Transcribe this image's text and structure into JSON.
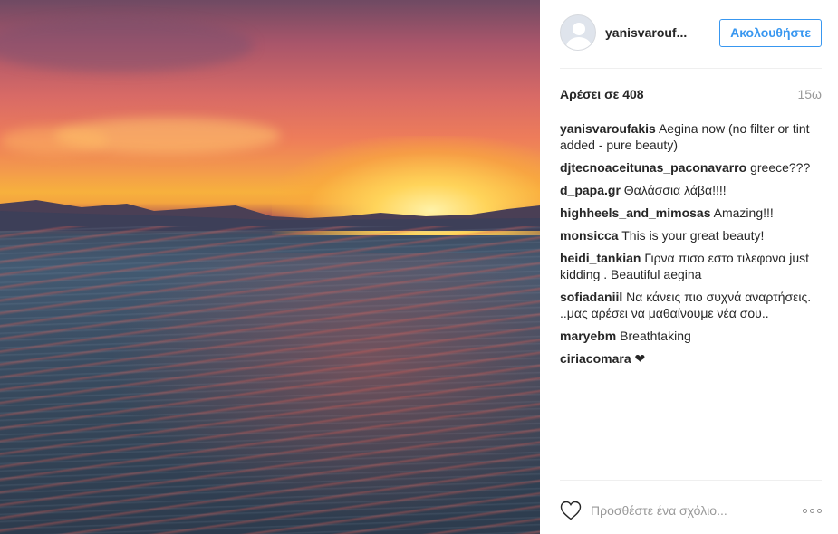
{
  "post": {
    "author": "yanisvarouf...",
    "follow_label": "Ακολουθήστε",
    "likes": "Αρέσει σε 408",
    "time": "15ω",
    "add_comment_placeholder": "Προσθέστε ένα σχόλιο...",
    "comments": [
      {
        "user": "yanisvaroufakis",
        "text": "Aegina now (no filter or tint added - pure beauty)"
      },
      {
        "user": "djtecnoaceitunas_paconavarro",
        "text": "greece???"
      },
      {
        "user": "d_papa.gr",
        "text": "Θαλάσσια λάβα!!!!"
      },
      {
        "user": "highheels_and_mimosas",
        "text": "Amazing!!!"
      },
      {
        "user": "monsicca",
        "text": "This is your great beauty!"
      },
      {
        "user": "heidi_tankian",
        "text": "Γιρνα πισο εστο τιλεφονα just kidding . Beautiful aegina"
      },
      {
        "user": "sofiadaniil",
        "text": "Να κάνεις πιο συχνά αναρτήσεις. ..μας αρέσει να μαθαίνουμε νέα σου.."
      },
      {
        "user": "maryebm",
        "text": "Breathtaking"
      },
      {
        "user": "ciriacomara",
        "text": "❤"
      }
    ]
  },
  "icons": {
    "heart": "heart-icon",
    "more": "more-options-icon",
    "avatar": "default-avatar-icon"
  },
  "colors": {
    "accent": "#3897f0",
    "text": "#262626",
    "muted": "#999999"
  }
}
